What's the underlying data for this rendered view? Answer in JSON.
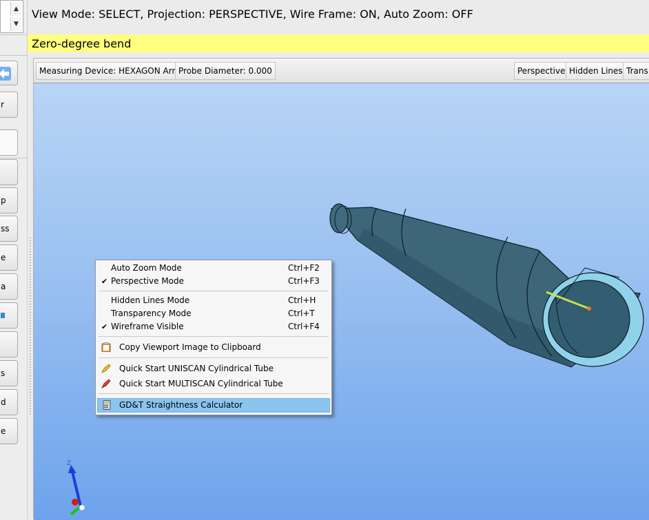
{
  "status": {
    "text": "View Mode: SELECT, Projection: PERSPECTIVE, Wire Frame: ON, Auto Zoom: OFF"
  },
  "title": {
    "text": "Zero-degree bend"
  },
  "left_strip": {
    "buttons": [
      "r",
      "p",
      "ss",
      "e",
      "a",
      "s",
      "d",
      "e"
    ]
  },
  "toolbar": {
    "measuring_device": "Measuring Device: HEXAGON Arm",
    "probe_diameter": "Probe Diameter: 0.000",
    "perspective": "Perspective",
    "hidden_lines": "Hidden Lines",
    "transparency": "Trans"
  },
  "axis": {
    "z_label": "Z"
  },
  "context_menu": {
    "items": [
      {
        "label": "Auto Zoom Mode",
        "shortcut": "Ctrl+F2",
        "checked": false
      },
      {
        "label": "Perspective Mode",
        "shortcut": "Ctrl+F3",
        "checked": true
      },
      {
        "label": "Hidden Lines Mode",
        "shortcut": "Ctrl+H",
        "checked": false
      },
      {
        "label": "Transparency Mode",
        "shortcut": "Ctrl+T",
        "checked": false
      },
      {
        "label": "Wireframe Visible",
        "shortcut": "Ctrl+F4",
        "checked": true
      },
      {
        "label": "Copy Viewport Image to Clipboard",
        "icon": "clipboard-icon"
      },
      {
        "label": "Quick Start UNISCAN Cylindrical Tube",
        "icon": "yellow-probe-icon"
      },
      {
        "label": "Quick Start MULTISCAN Cylindrical Tube",
        "icon": "red-probe-icon"
      },
      {
        "label": "GD&T Straightness Calculator",
        "icon": "calculator-icon",
        "highlighted": true
      }
    ],
    "check_glyph": "✔"
  },
  "colors": {
    "title_bg": "#ffff80",
    "tube": "#3a6478",
    "tube_rim": "#8fd2ea",
    "menu_highlight": "#8cc4f0"
  }
}
